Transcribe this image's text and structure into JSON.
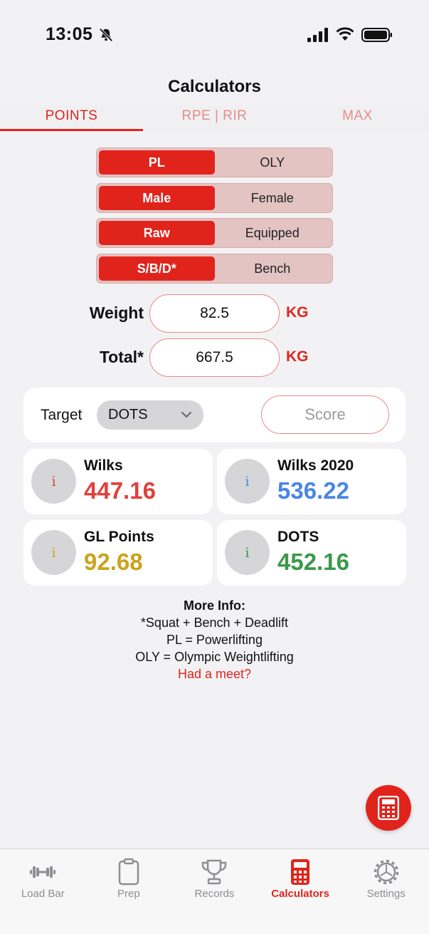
{
  "status": {
    "time": "13:05"
  },
  "nav": {
    "title": "Calculators"
  },
  "top_tabs": [
    {
      "label": "POINTS",
      "active": true
    },
    {
      "label": "RPE | RIR",
      "active": false
    },
    {
      "label": "MAX",
      "active": false
    }
  ],
  "segments": [
    {
      "options": [
        "PL",
        "OLY"
      ],
      "selected": "PL"
    },
    {
      "options": [
        "Male",
        "Female"
      ],
      "selected": "Male"
    },
    {
      "options": [
        "Raw",
        "Equipped"
      ],
      "selected": "Raw"
    },
    {
      "options": [
        "S/B/D*",
        "Bench"
      ],
      "selected": "S/B/D*"
    }
  ],
  "fields": {
    "weight": {
      "label": "Weight",
      "value": "82.5",
      "unit": "KG"
    },
    "total": {
      "label": "Total*",
      "value": "667.5",
      "unit": "KG"
    }
  },
  "target": {
    "label": "Target",
    "selected": "DOTS",
    "score_placeholder": "Score"
  },
  "results": [
    {
      "name": "Wilks",
      "value": "447.16",
      "color": "#e0413a"
    },
    {
      "name": "Wilks 2020",
      "value": "536.22",
      "color": "#4a86e8"
    },
    {
      "name": "GL Points",
      "value": "92.68",
      "color": "#c9a41b"
    },
    {
      "name": "DOTS",
      "value": "452.16",
      "color": "#3a9a4a"
    }
  ],
  "info_glyph": "i",
  "more_info": {
    "title": "More Info:",
    "lines": [
      "*Squat + Bench + Deadlift",
      "PL = Powerlifting",
      "OLY = Olympic Weightlifting"
    ],
    "link": "Had a meet?"
  },
  "tab_bar": [
    {
      "label": "Load Bar",
      "icon": "barbell-icon",
      "active": false
    },
    {
      "label": "Prep",
      "icon": "clipboard-icon",
      "active": false
    },
    {
      "label": "Records",
      "icon": "trophy-icon",
      "active": false
    },
    {
      "label": "Calculators",
      "icon": "calculator-icon",
      "active": true
    },
    {
      "label": "Settings",
      "icon": "gear-icon",
      "active": false
    }
  ],
  "colors": {
    "accent": "#e0241c",
    "accent_light": "#e88a86"
  }
}
